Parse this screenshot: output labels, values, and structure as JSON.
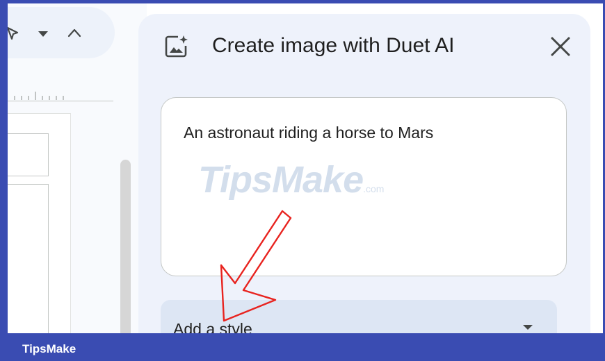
{
  "panel": {
    "title": "Create image with Duet AI",
    "prompt_text": "An astronaut riding a horse to Mars",
    "style_select_label": "Add a style"
  },
  "watermark": {
    "main": "TipsMake",
    "suffix": ".com"
  },
  "footer": {
    "brand": "TipsMake"
  },
  "colors": {
    "frame": "#3a4cb2",
    "panel_bg": "#eef2fb",
    "select_bg": "#dde6f4",
    "arrow": "#e8231f"
  },
  "icons": {
    "toolbar": [
      "pen-tool-icon",
      "chevron-down-icon",
      "chevron-up-icon"
    ],
    "panel_header": "image-sparkle-icon",
    "close": "close-icon",
    "select_caret": "caret-down-icon"
  }
}
